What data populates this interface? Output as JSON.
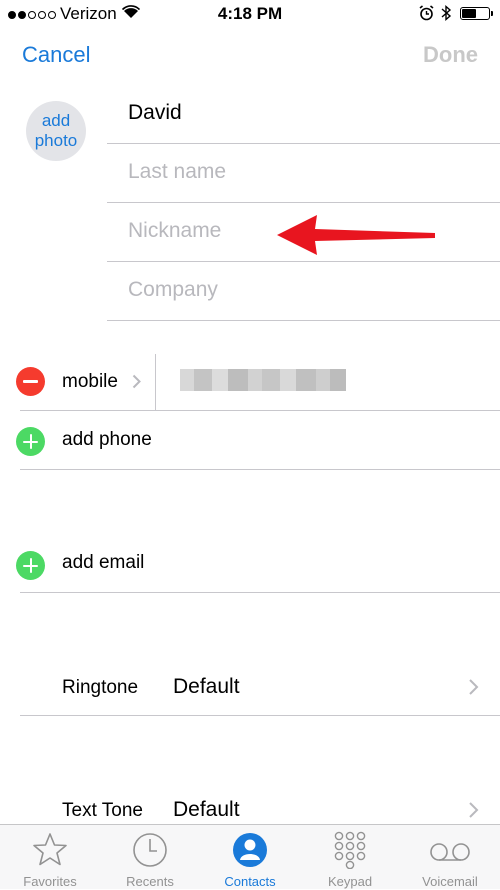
{
  "status_bar": {
    "signal_filled": 2,
    "signal_total": 5,
    "carrier": "Verizon",
    "time": "4:18 PM",
    "battery_level": 0.55
  },
  "nav": {
    "cancel_label": "Cancel",
    "done_label": "Done"
  },
  "photo": {
    "line1": "add",
    "line2": "photo"
  },
  "name_fields": {
    "first_name": "David",
    "last_name_placeholder": "Last name",
    "nickname_placeholder": "Nickname",
    "company_placeholder": "Company"
  },
  "phone": {
    "label": "mobile"
  },
  "add_phone_label": "add phone",
  "add_email_label": "add email",
  "ringtone": {
    "label": "Ringtone",
    "value": "Default"
  },
  "text_tone": {
    "label": "Text Tone",
    "value": "Default"
  },
  "tabs": [
    {
      "label": "Favorites",
      "icon": "star-icon"
    },
    {
      "label": "Recents",
      "icon": "clock-icon"
    },
    {
      "label": "Contacts",
      "icon": "person-icon"
    },
    {
      "label": "Keypad",
      "icon": "keypad-icon"
    },
    {
      "label": "Voicemail",
      "icon": "voicemail-icon"
    }
  ],
  "colors": {
    "accent": "#1a7ad9",
    "delete": "#f53b2e",
    "add": "#4cd964",
    "annotation_arrow": "#e8151f"
  }
}
